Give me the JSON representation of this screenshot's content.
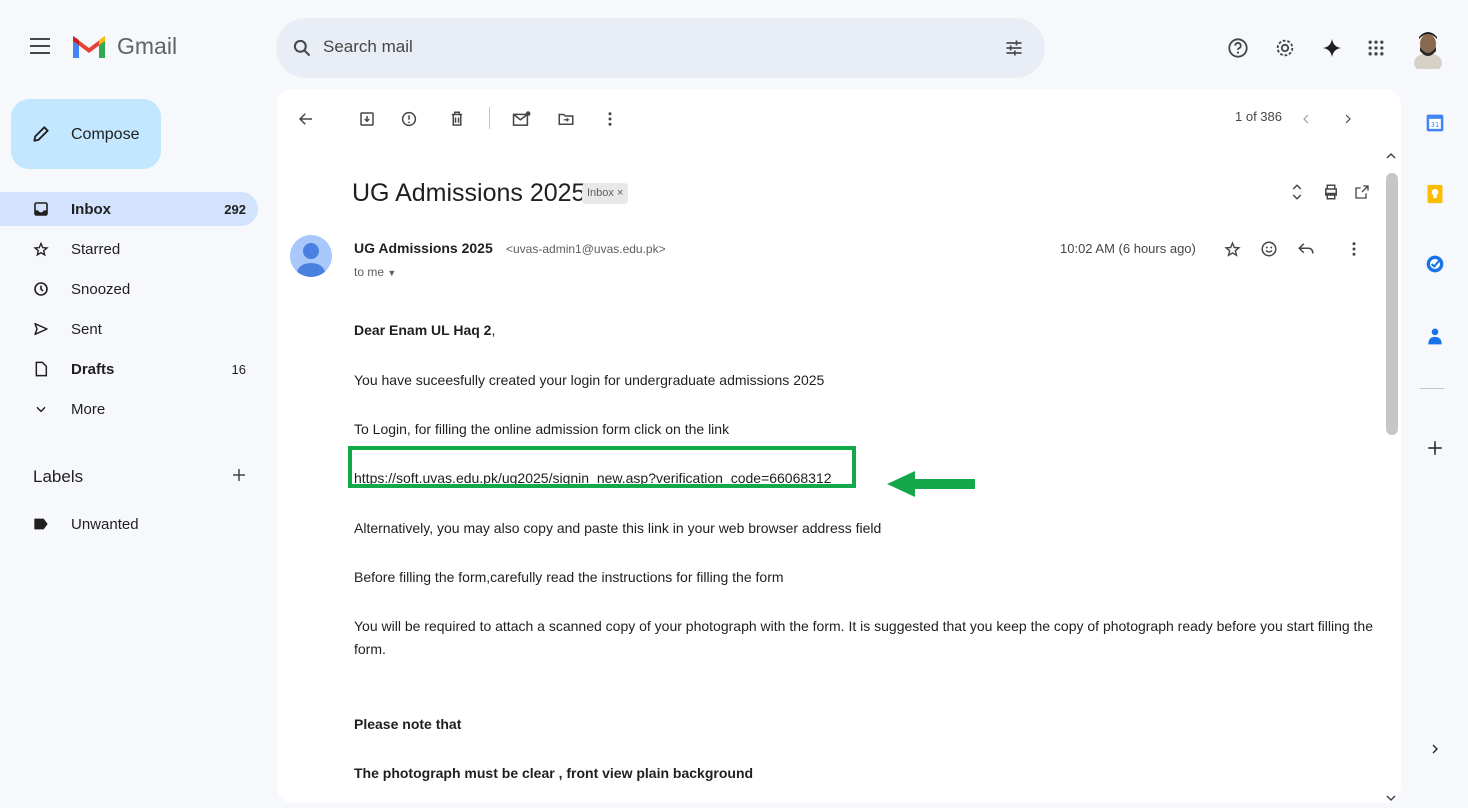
{
  "app": {
    "title": "Gmail"
  },
  "search": {
    "placeholder": "Search mail"
  },
  "compose": {
    "label": "Compose"
  },
  "sidebar": {
    "items": [
      {
        "label": "Inbox",
        "count": "292",
        "icon": "inbox-icon"
      },
      {
        "label": "Starred",
        "count": "",
        "icon": "star-icon"
      },
      {
        "label": "Snoozed",
        "count": "",
        "icon": "clock-icon"
      },
      {
        "label": "Sent",
        "count": "",
        "icon": "send-icon"
      },
      {
        "label": "Drafts",
        "count": "16",
        "icon": "draft-icon"
      },
      {
        "label": "More",
        "count": "",
        "icon": "chevron-down-icon"
      }
    ],
    "labels_title": "Labels",
    "labels": [
      {
        "label": "Unwanted",
        "icon": "label-icon"
      }
    ]
  },
  "toolbar": {
    "pager": "1 of 386"
  },
  "message": {
    "subject": "UG Admissions 2025",
    "chip": "Inbox ×",
    "sender_name": "UG Admissions 2025",
    "sender_email": "<uvas-admin1@uvas.edu.pk>",
    "recipient": "to me",
    "time": "10:02 AM (6 hours ago)"
  },
  "body": {
    "greeting_prefix": "Dear ",
    "greeting_name": "Enam UL Haq 2",
    "greeting_suffix": ",",
    "line1": "You have suceesfully created your login for undergraduate admissions 2025",
    "line2": "To Login, for filling the online admission form click on the link",
    "link": "https://soft.uvas.edu.pk/ug2025/signin_new.asp?verification_code=66068312",
    "line3": "Alternatively, you may also copy and paste this link in your web browser address field",
    "line4": "Before filling the form,carefully read the instructions for filling the form",
    "line5a": "You will be required to attach a scanned copy of your photograph with the form. It is suggested that you keep the copy of photograph ready before you start filling the",
    "line5b": "form.",
    "note": "Please note that",
    "line6": "The photograph must be clear , front view plain background"
  },
  "colors": {
    "highlight_box": "#14a84b",
    "link": "#1a0dab",
    "compose_bg": "#c2e7ff",
    "active_nav": "#d3e3fd"
  }
}
